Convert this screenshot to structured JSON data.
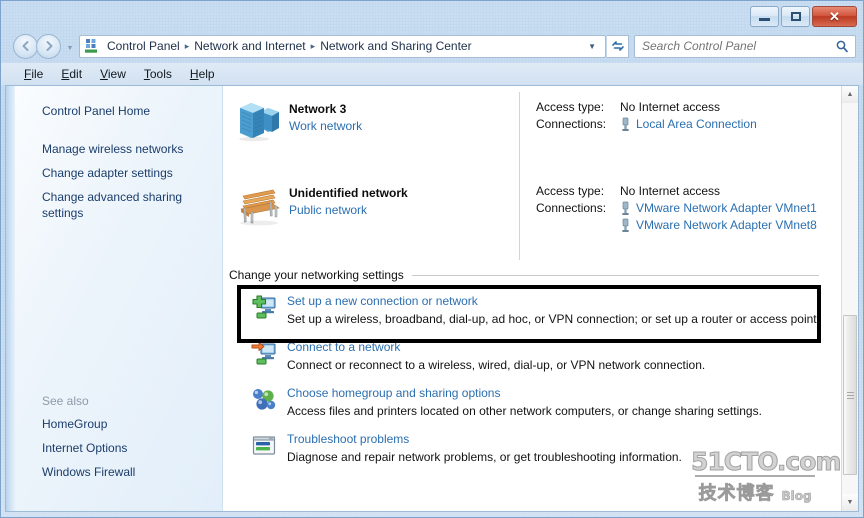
{
  "window": {
    "title": "Network and Sharing Center",
    "minimize_label": "Minimize",
    "maximize_label": "Maximize",
    "close_label": "Close"
  },
  "nav": {
    "back_label": "Back",
    "forward_label": "Forward",
    "recent_dropdown_label": "Recent pages",
    "breadcrumbs": [
      "Control Panel",
      "Network and Internet",
      "Network and Sharing Center"
    ],
    "separator": "▸",
    "address_caret": "▼",
    "refresh_label": "Refresh",
    "refresh_glyph": "↻"
  },
  "search": {
    "placeholder": "Search Control Panel",
    "value": "",
    "icon_glyph": "⌕"
  },
  "menubar": {
    "items": [
      {
        "accel": "F",
        "rest": "ile"
      },
      {
        "accel": "E",
        "rest": "dit"
      },
      {
        "accel": "V",
        "rest": "iew"
      },
      {
        "accel": "T",
        "rest": "ools"
      },
      {
        "accel": "H",
        "rest": "elp"
      }
    ]
  },
  "sidebar": {
    "home": "Control Panel Home",
    "items": [
      "Manage wireless networks",
      "Change adapter settings",
      "Change advanced sharing settings"
    ],
    "see_also_title": "See also",
    "see_also": [
      "HomeGroup",
      "Internet Options",
      "Windows Firewall"
    ]
  },
  "networks": [
    {
      "icon": "server-stack-icon",
      "name": "Network  3",
      "type": "Work network",
      "access_label": "Access type:",
      "access_value": "No Internet access",
      "connections_label": "Connections:",
      "connections": [
        "Local Area Connection"
      ]
    },
    {
      "icon": "park-bench-icon",
      "name": "Unidentified network",
      "type": "Public network",
      "access_label": "Access type:",
      "access_value": "No Internet access",
      "connections_label": "Connections:",
      "connections": [
        "VMware Network Adapter VMnet1",
        "VMware Network Adapter VMnet8"
      ]
    }
  ],
  "section": {
    "heading": "Change your networking settings"
  },
  "tasks": [
    {
      "icon": "new-connection-icon",
      "title": "Set up a new connection or network",
      "desc": "Set up a wireless, broadband, dial-up, ad hoc, or VPN connection; or set up a router or access point.",
      "highlighted": true
    },
    {
      "icon": "connect-network-icon",
      "title": "Connect to a network",
      "desc": "Connect or reconnect to a wireless, wired, dial-up, or VPN network connection.",
      "highlighted": false
    },
    {
      "icon": "homegroup-icon",
      "title": "Choose homegroup and sharing options",
      "desc": "Access files and printers located on other network computers, or change sharing settings.",
      "highlighted": false
    },
    {
      "icon": "troubleshoot-icon",
      "title": "Troubleshoot problems",
      "desc": "Diagnose and repair network problems, or get troubleshooting information.",
      "highlighted": false
    }
  ],
  "watermark": {
    "top": "51CTO.com",
    "bottom_cn": "技术博客",
    "bottom_en": "Blog"
  },
  "scrollbar": {
    "up_glyph": "▲",
    "down_glyph": "▼"
  },
  "colors": {
    "link": "#2b6fb0",
    "sidebar_link": "#1b3d6b",
    "highlight_border": "#000000",
    "frame": "#c3d9ef"
  }
}
